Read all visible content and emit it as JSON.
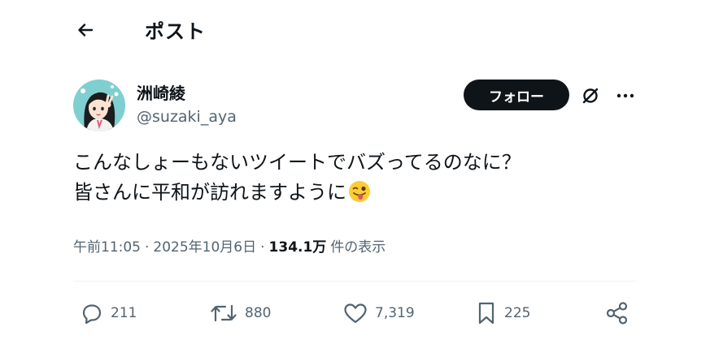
{
  "header": {
    "title": "ポスト",
    "back_icon": "arrow-left-icon"
  },
  "author": {
    "display_name": "洲崎綾",
    "handle": "@suzaki_aya",
    "avatar_icon": "avatar-illustration"
  },
  "follow_button": {
    "label": "フォロー"
  },
  "grok_icon": "grok-slash-icon",
  "more_icon": "more-dots-icon",
  "tweet": {
    "lines": [
      "こんなしょーもないツイートでバズってるのなに？",
      "皆さんに平和が訪れますように"
    ],
    "trailing_emoji": "winking-tongue-emoji"
  },
  "meta": {
    "time": "午前11:05",
    "separator": "·",
    "date": "2025年10月6日",
    "views_count": "134.1万",
    "views_suffix": "件の表示"
  },
  "actions": {
    "replies": {
      "icon": "reply-icon",
      "count": "211"
    },
    "reposts": {
      "icon": "repost-icon",
      "count": "880"
    },
    "likes": {
      "icon": "heart-icon",
      "count": "7,319"
    },
    "bookmarks": {
      "icon": "bookmark-icon",
      "count": "225"
    },
    "share": {
      "icon": "share-icon"
    }
  },
  "colors": {
    "text": "#0f1419",
    "muted": "#536471",
    "divider": "#eff3f4",
    "follow_bg": "#0f1419",
    "avatar_bg": "#7fcfd0"
  }
}
